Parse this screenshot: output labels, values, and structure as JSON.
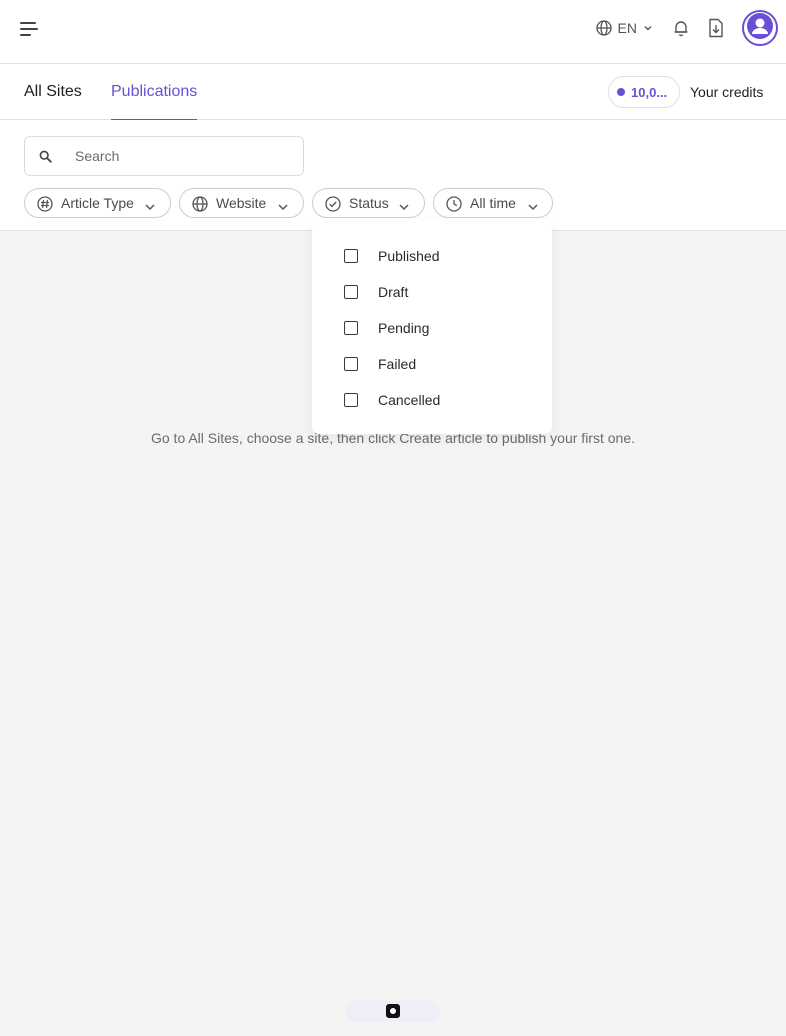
{
  "header": {
    "language": "EN",
    "icons": [
      "menu-icon",
      "globe-icon",
      "chevron-down-icon",
      "bell-icon",
      "download-icon",
      "user-icon"
    ]
  },
  "tabs": {
    "all_sites": "All Sites",
    "publications": "Publications",
    "active": "Publications"
  },
  "credits": {
    "value": "10,0...",
    "label": "Your credits"
  },
  "search": {
    "placeholder": "Search",
    "value": ""
  },
  "filters": {
    "article_type": "Article Type",
    "website": "Website",
    "status": "Status",
    "time": "All time"
  },
  "status_dropdown": {
    "options": [
      {
        "label": "Published",
        "checked": false
      },
      {
        "label": "Draft",
        "checked": false
      },
      {
        "label": "Pending",
        "checked": false
      },
      {
        "label": "Failed",
        "checked": false
      },
      {
        "label": "Cancelled",
        "checked": false
      }
    ]
  },
  "empty_state": {
    "message": "Go to All Sites, choose a site, then click Create article to publish your first one."
  },
  "colors": {
    "accent": "#6a4fd6",
    "background": "#f5f4f3",
    "surface": "#ffffff",
    "border": "#e3e1df"
  }
}
